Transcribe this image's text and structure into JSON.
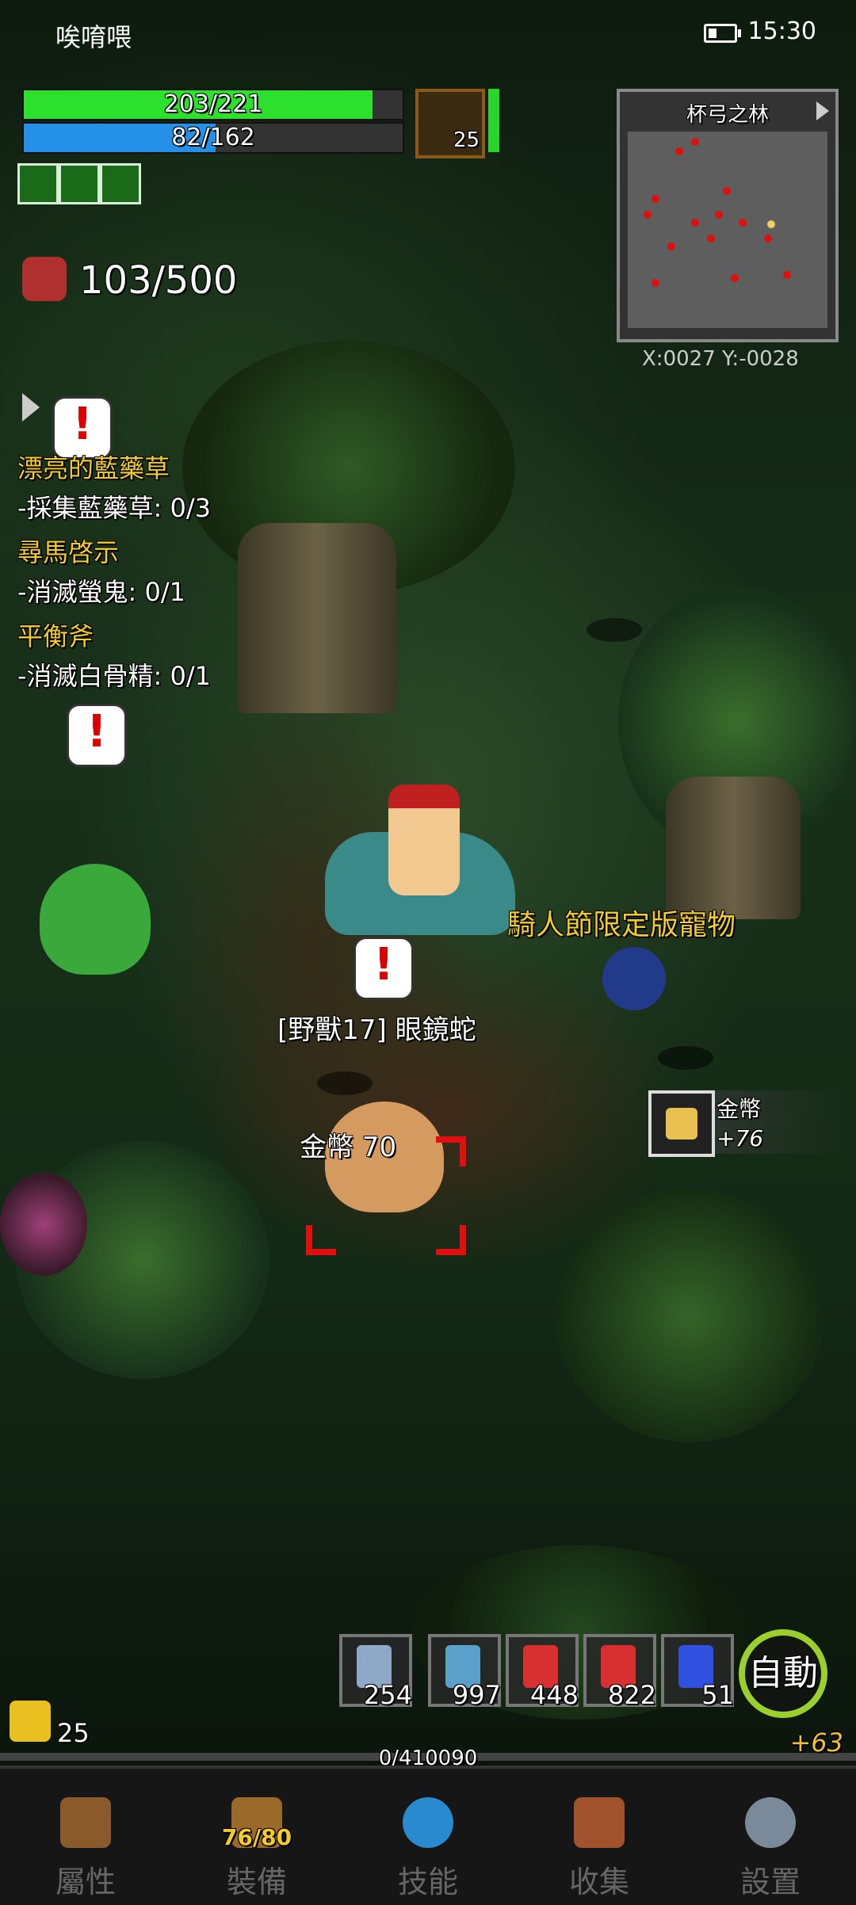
{
  "status_bar": {
    "app_name": "唉唷喂",
    "time": "15:30"
  },
  "player": {
    "hp_text": "203/221",
    "hp_fraction": 0.92,
    "mp_text": "82/162",
    "mp_fraction": 0.506
  },
  "pet": {
    "level": "25"
  },
  "minimap": {
    "title": "杯弓之林",
    "coords": "X:0027  Y:-0028"
  },
  "kill_counter": {
    "text": "103/500"
  },
  "quests": [
    {
      "title": "漂亮的藍藥草",
      "task": "-採集藍藥草: 0/3"
    },
    {
      "title": "尋馬啓示",
      "task": "-消滅螢鬼: 0/1"
    },
    {
      "title": "平衡斧",
      "task": "-消滅白骨精: 0/1"
    }
  ],
  "world": {
    "pet_title": "騎人節限定版寵物",
    "monster_name": "[野獸17] 眼鏡蛇",
    "gold_drop": "金幣 70",
    "loot_name": "金幣",
    "loot_amount": "+76"
  },
  "quickbar": {
    "slots": [
      {
        "count": "254",
        "color": "#8fa8c8"
      },
      {
        "count": "997",
        "color": "#5aa0c8"
      },
      {
        "count": "448",
        "color": "#d83030"
      },
      {
        "count": "822",
        "color": "#d83030"
      },
      {
        "count": "51",
        "color": "#3050e0"
      }
    ],
    "auto_label": "自動"
  },
  "level": "25",
  "exp": {
    "text": "0/410090",
    "gain": "+63"
  },
  "nav": {
    "attributes": "屬性",
    "equipment": "裝備",
    "equipment_badge": "76/80",
    "skills": "技能",
    "collection": "收集",
    "settings": "設置"
  }
}
